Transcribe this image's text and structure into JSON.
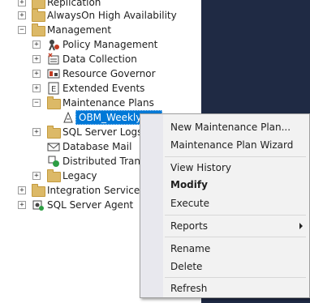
{
  "tree": {
    "items": [
      {
        "label": "Replication"
      },
      {
        "label": "AlwaysOn High Availability"
      },
      {
        "label": "Management"
      },
      {
        "label": "Policy Management"
      },
      {
        "label": "Data Collection"
      },
      {
        "label": "Resource Governor"
      },
      {
        "label": "Extended Events"
      },
      {
        "label": "Maintenance Plans"
      },
      {
        "label": "OBM_Weekly_Ba"
      },
      {
        "label": "SQL Server Logs"
      },
      {
        "label": "Database Mail"
      },
      {
        "label": "Distributed Transa"
      },
      {
        "label": "Legacy"
      },
      {
        "label": "Integration Services Ca"
      },
      {
        "label": "SQL Server Agent"
      }
    ]
  },
  "context_menu": {
    "items": [
      {
        "label": "New Maintenance Plan..."
      },
      {
        "label": "Maintenance Plan Wizard"
      },
      {
        "label": "View History"
      },
      {
        "label": "Modify"
      },
      {
        "label": "Execute"
      },
      {
        "label": "Reports"
      },
      {
        "label": "Rename"
      },
      {
        "label": "Delete"
      },
      {
        "label": "Refresh"
      }
    ]
  },
  "colors": {
    "selection": "#0078d7",
    "dark_panel": "#1f2a44"
  }
}
